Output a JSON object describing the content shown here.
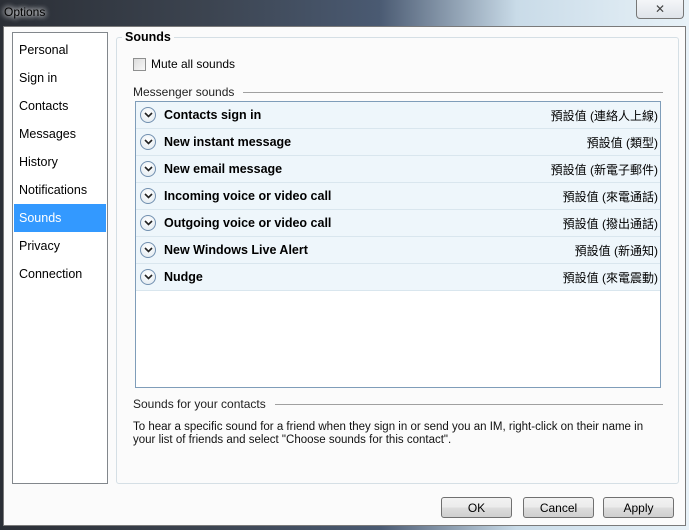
{
  "window": {
    "title": "Options",
    "close_icon": "close-x-icon"
  },
  "sidebar": {
    "items": [
      {
        "label": "Personal",
        "selected": false
      },
      {
        "label": "Sign in",
        "selected": false
      },
      {
        "label": "Contacts",
        "selected": false
      },
      {
        "label": "Messages",
        "selected": false
      },
      {
        "label": "History",
        "selected": false
      },
      {
        "label": "Notifications",
        "selected": false
      },
      {
        "label": "Sounds",
        "selected": true
      },
      {
        "label": "Privacy",
        "selected": false
      },
      {
        "label": "Connection",
        "selected": false
      }
    ]
  },
  "panel": {
    "title": "Sounds",
    "mute_all": {
      "label": "Mute all sounds",
      "checked": false
    },
    "messenger_sounds_label": "Messenger sounds",
    "sounds": [
      {
        "name": "Contacts sign in",
        "value": "預設值 (連絡人上線)"
      },
      {
        "name": "New instant message",
        "value": "預設值 (類型)"
      },
      {
        "name": "New email message",
        "value": "預設值 (新電子郵件)"
      },
      {
        "name": "Incoming voice or video call",
        "value": "預設值 (來電通話)"
      },
      {
        "name": "Outgoing voice or video call",
        "value": "預設值 (撥出通話)"
      },
      {
        "name": "New Windows Live Alert",
        "value": "預設值 (新通知)"
      },
      {
        "name": "Nudge",
        "value": "預設值 (來電震動)"
      }
    ],
    "contacts_sounds_label": "Sounds for your contacts",
    "contacts_sounds_description": "To hear a specific sound for a friend when they sign in or send you an IM, right-click on their name in your list of friends and select \"Choose sounds for this contact\"."
  },
  "buttons": {
    "ok": "OK",
    "cancel": "Cancel",
    "apply": "Apply"
  }
}
